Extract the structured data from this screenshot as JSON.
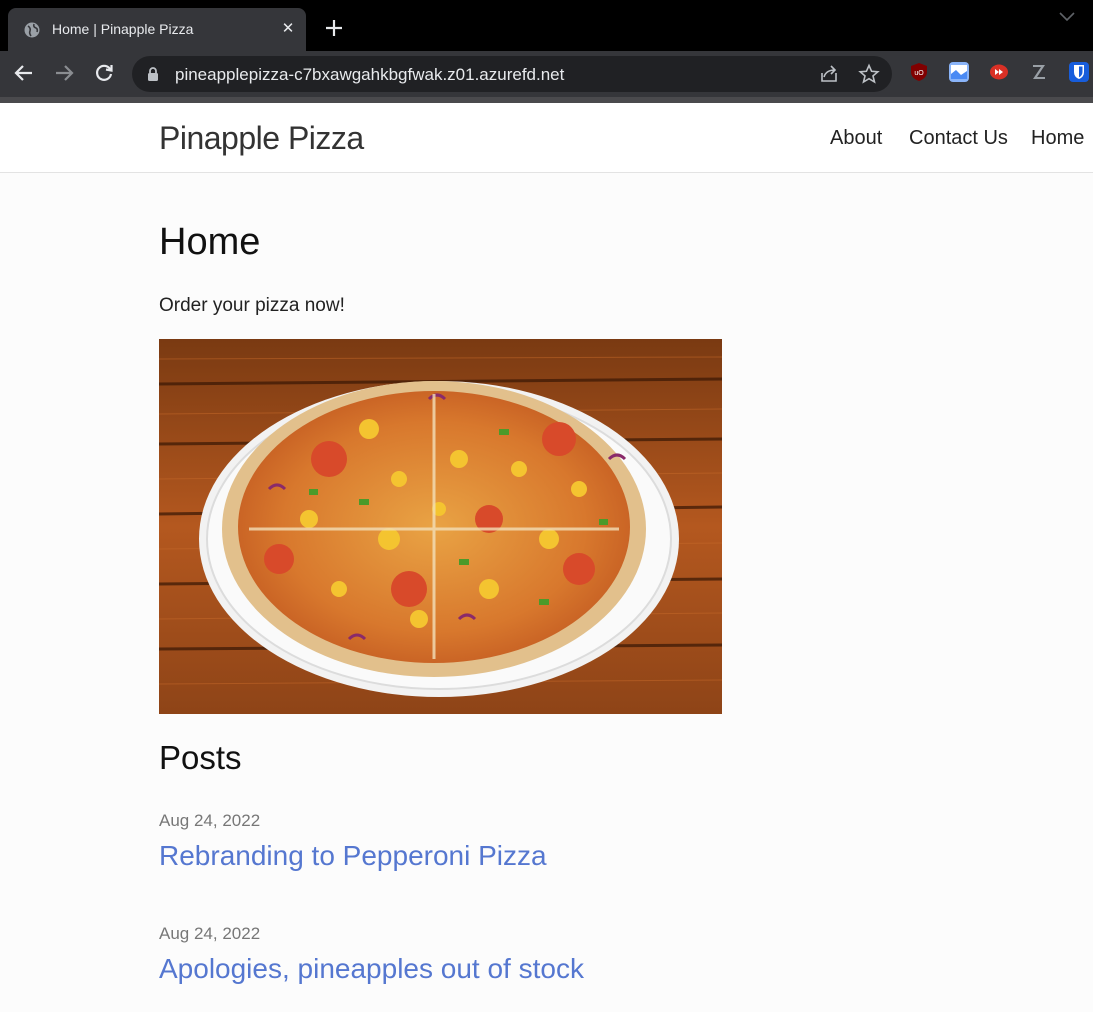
{
  "browser": {
    "tab_title": "Home | Pinapple Pizza",
    "tab_close": "✕",
    "url": "pineapplepizza-c7bxawgahkbgfwak.z01.azurefd.net"
  },
  "site": {
    "brand": "Pinapple Pizza",
    "nav": [
      {
        "label": "About"
      },
      {
        "label": "Contact Us"
      },
      {
        "label": "Home"
      }
    ]
  },
  "main": {
    "heading": "Home",
    "lead": "Order your pizza now!",
    "posts_heading": "Posts",
    "posts": [
      {
        "date": "Aug 24, 2022",
        "title": "Rebranding to Pepperoni Pizza"
      },
      {
        "date": "Aug 24, 2022",
        "title": "Apologies, pineapples out of stock"
      }
    ]
  },
  "colors": {
    "link": "#5577d0",
    "chrome_dark": "#35363a"
  }
}
